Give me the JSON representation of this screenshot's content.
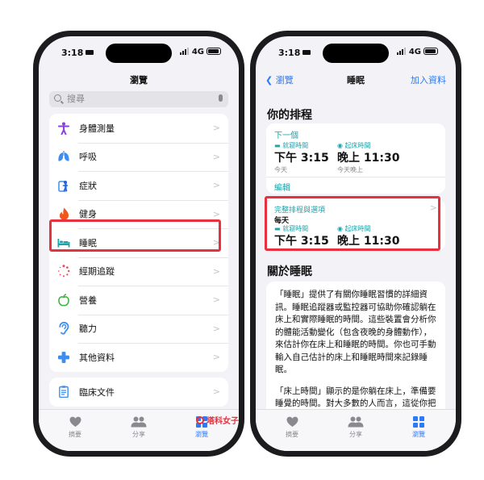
{
  "status": {
    "time": "3:18",
    "network": "4G"
  },
  "left_screen": {
    "title": "瀏覽",
    "search_placeholder": "搜尋",
    "items": [
      {
        "label": "身體測量",
        "icon": "figure-icon"
      },
      {
        "label": "呼吸",
        "icon": "lungs-icon"
      },
      {
        "label": "症狀",
        "icon": "clipboard-figure-icon"
      },
      {
        "label": "健身",
        "icon": "flame-icon"
      },
      {
        "label": "睡眠",
        "icon": "bed-icon"
      },
      {
        "label": "經期追蹤",
        "icon": "cycle-icon"
      },
      {
        "label": "營養",
        "icon": "apple-icon"
      },
      {
        "label": "聽力",
        "icon": "ear-icon"
      },
      {
        "label": "其他資料",
        "icon": "plus-icon"
      }
    ],
    "extra_item": {
      "label": "臨床文件",
      "icon": "document-icon"
    },
    "chevron": ">"
  },
  "right_screen": {
    "back_label": "瀏覽",
    "title": "睡眠",
    "add_label": "加入資料",
    "schedule_header": "你的排程",
    "next_label": "下一個",
    "bedtime_label": "就寢時間",
    "wake_label": "起床時間",
    "next_bedtime": "下午 3:15",
    "next_wake": "晚上 11:30",
    "next_bed_day": "今天",
    "next_wake_day": "今天晚上",
    "edit_label": "編輯",
    "full_schedule_label": "完整排程與選項",
    "full_every_day": "每天",
    "full_bedtime": "下午 3:15",
    "full_wake": "晚上 11:30",
    "about_header": "關於睡眠",
    "about_p1": "「睡眠」提供了有關你睡眠習慣的詳細資訊。睡眠追蹤器或監控器可協助你確認躺在床上和實際睡眠的時間。這些裝置會分析你的體能活動變化（包含夜晚的身體動作），來估計你在床上和睡眠的時間。你也可手動輸入自己估計的床上和睡眠時間來記錄睡眠。",
    "about_p2": "「床上時間」顯示的是你躺在床上，準備要睡覺的時間。對大多數的人而言，這從你把燈關掉開始計算，直到你起床後結束。"
  },
  "tabs": [
    {
      "label": "摘要",
      "icon": "heart-icon"
    },
    {
      "label": "分享",
      "icon": "people-icon"
    },
    {
      "label": "瀏覽",
      "icon": "grid-icon",
      "active": true
    }
  ],
  "watermark": "塔科女子",
  "colors": {
    "accent": "#2a7bf6",
    "highlight": "#e8313e",
    "sleep": "#1fa3a8"
  }
}
